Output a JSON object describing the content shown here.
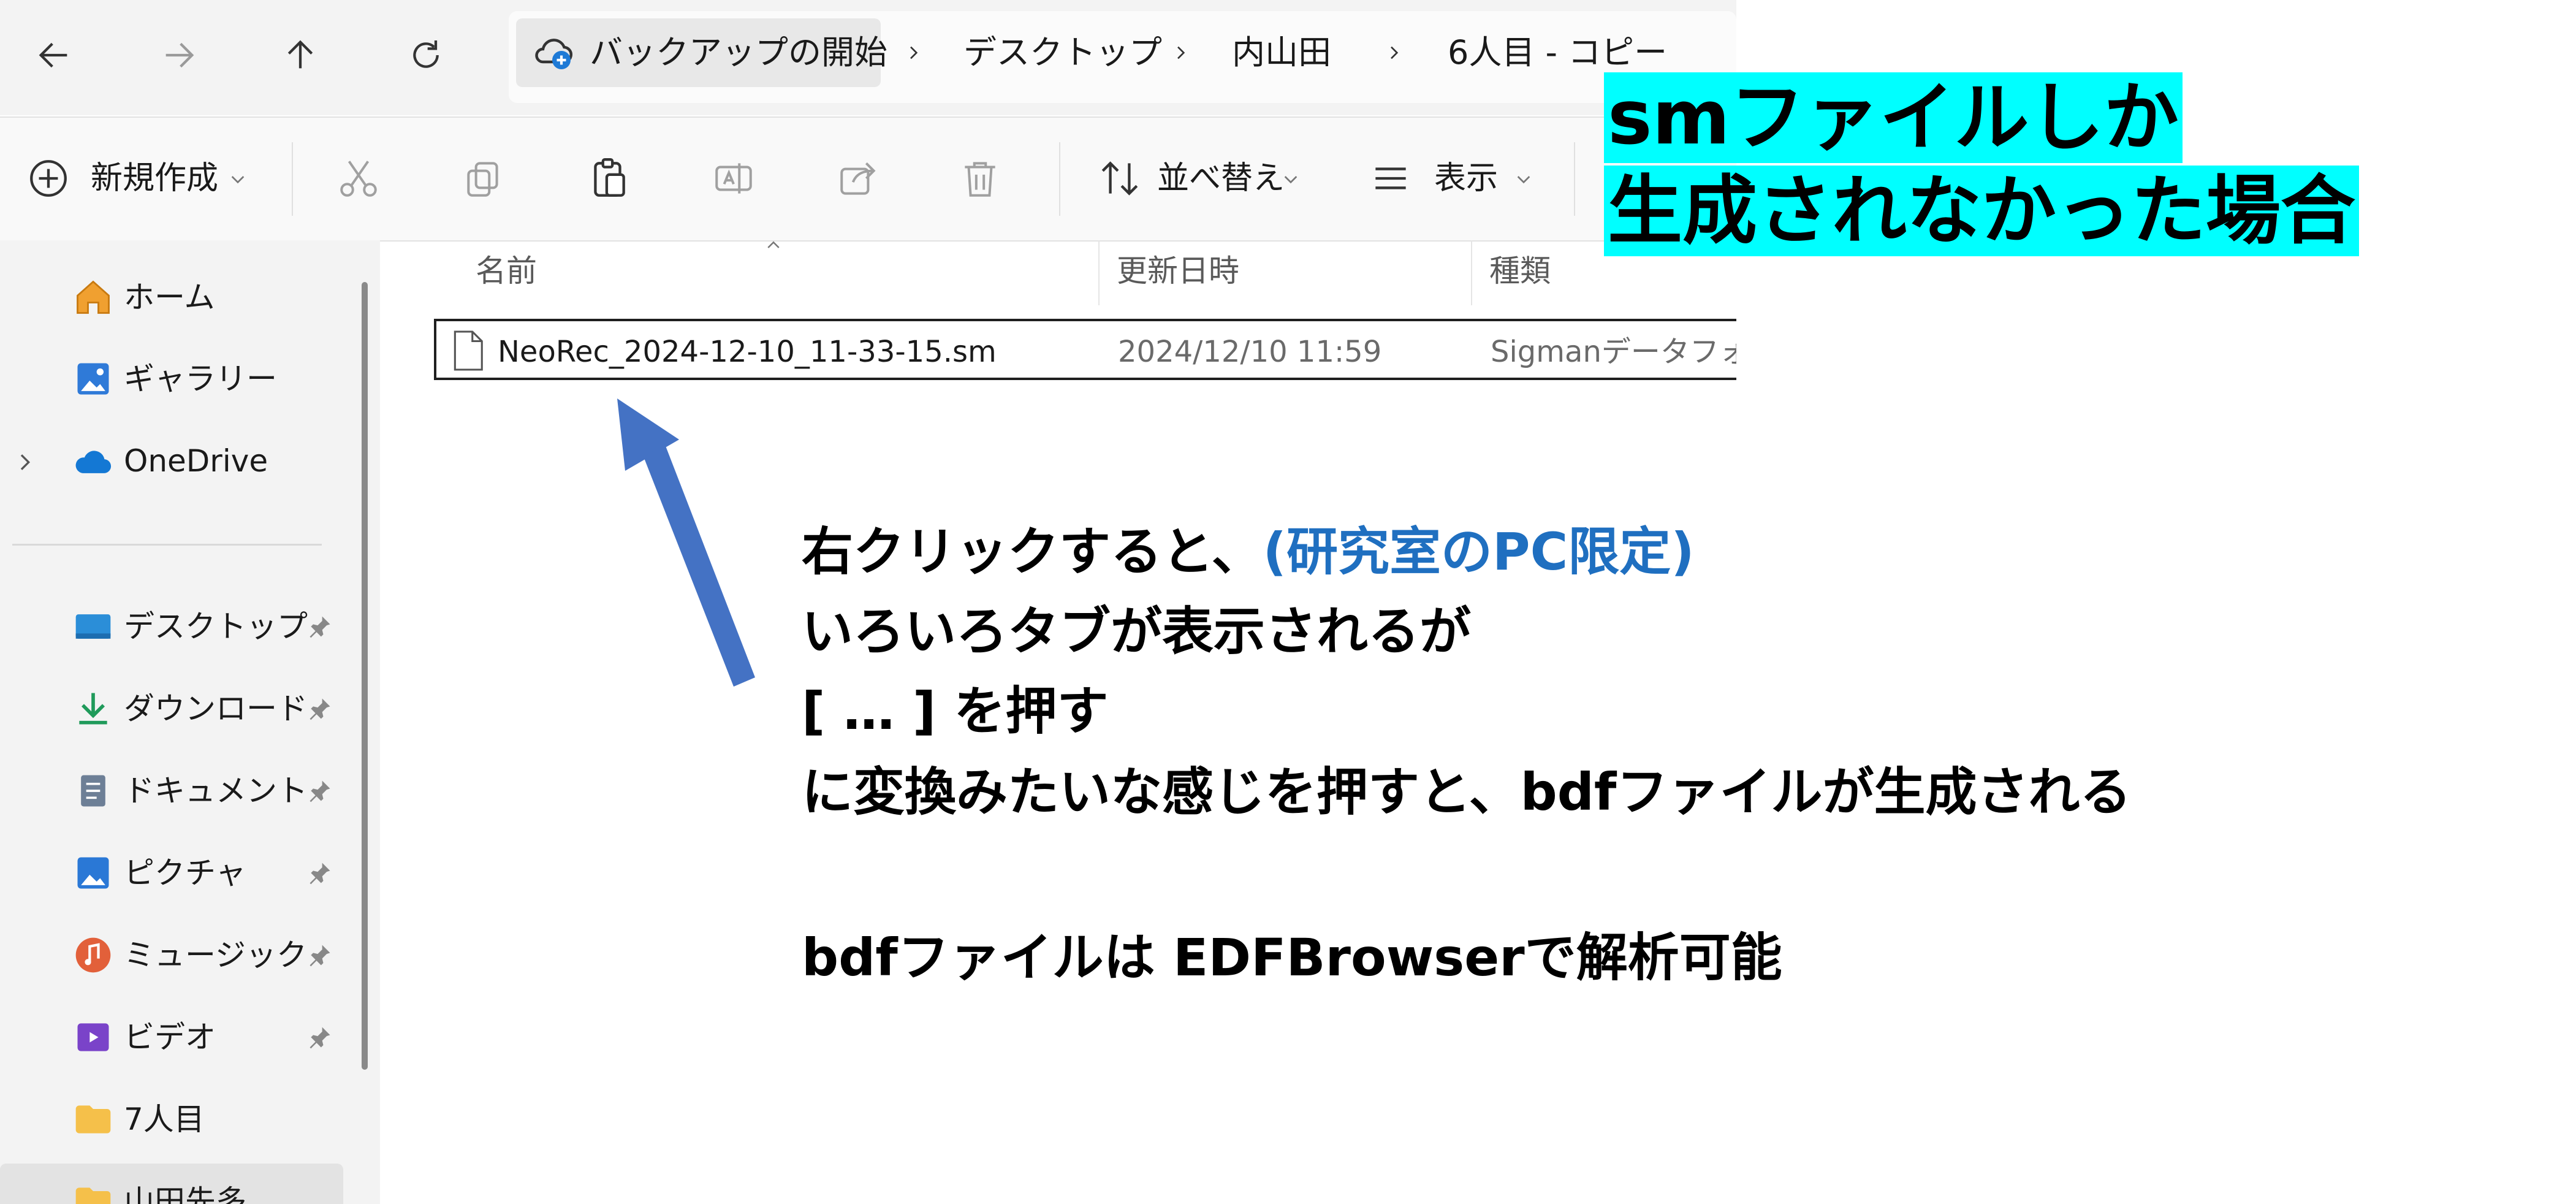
{
  "window": {
    "nav": {
      "back_icon": "arrow-left-icon",
      "forward_icon": "arrow-right-icon",
      "up_icon": "arrow-up-icon",
      "refresh_icon": "refresh-icon"
    },
    "breadcrumb": {
      "items": [
        "バックアップの開始",
        "デスクトップ",
        "内山田",
        "6人目 - コピー"
      ]
    },
    "toolbar": {
      "new_label": "新規作成",
      "sort_label": "並べ替え",
      "view_label": "表示"
    },
    "sidebar": {
      "items": [
        {
          "label": "ホーム",
          "icon": "home-icon"
        },
        {
          "label": "ギャラリー",
          "icon": "gallery-icon"
        },
        {
          "label": "OneDrive",
          "icon": "cloud-icon"
        },
        {
          "label": "デスクトップ",
          "icon": "desktop-icon"
        },
        {
          "label": "ダウンロード",
          "icon": "download-icon"
        },
        {
          "label": "ドキュメント",
          "icon": "document-icon"
        },
        {
          "label": "ピクチャ",
          "icon": "pictures-icon"
        },
        {
          "label": "ミュージック",
          "icon": "music-icon"
        },
        {
          "label": "ビデオ",
          "icon": "video-icon"
        },
        {
          "label": "7人目",
          "icon": "folder-icon"
        },
        {
          "label": "山田先多",
          "icon": "folder-icon"
        }
      ]
    },
    "columns": [
      "名前",
      "更新日時",
      "種類"
    ],
    "files": [
      {
        "name": "NeoRec_2024-12-10_11-33-15.sm",
        "modified": "2024/12/10 11:59",
        "type": "Sigmanデータフォー..."
      }
    ]
  },
  "annotation": {
    "title_lines": [
      "smファイルしか",
      "生成されなかった場合"
    ],
    "note1_main": "右クリックすると、",
    "note1_highlight": "(研究室のPC限定)",
    "note2": "いろいろタブが表示されるが",
    "note3": "[ … ] を押す",
    "note4": "に変換みたいな感じを押すと、bdfファイルが生成される",
    "note5": "bdfファイルは EDFBrowserで解析可能",
    "highlight_color": "#00ffff",
    "note_accent_color": "#1f6fc0",
    "arrow_color": "#4472c4"
  }
}
